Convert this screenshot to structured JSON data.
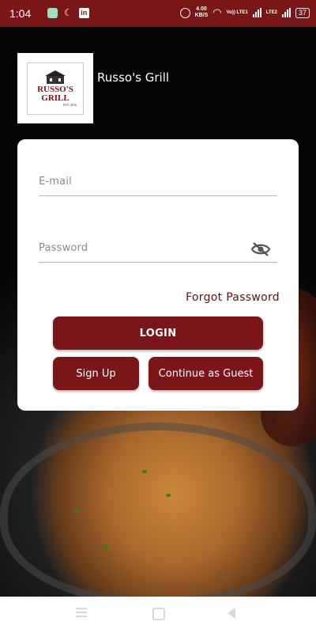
{
  "status_bar": {
    "time": "1:04",
    "speed_value": "4.00",
    "speed_unit": "KB/S",
    "volte_top": "Vo)) LTE1",
    "volte_bottom": "LTE2",
    "battery": "37",
    "icons": [
      "whatsapp-icon",
      "moon-icon",
      "linkedin-icon",
      "alarm-icon",
      "wifi-icon",
      "signal-icon",
      "battery-icon"
    ]
  },
  "header": {
    "logo": {
      "line1": "RUSSO'S",
      "line2": "GRILL",
      "est": "EST. 2016"
    },
    "restaurant_name": "Russo's Grill"
  },
  "login_form": {
    "email_placeholder": "E-mail",
    "password_placeholder": "Password",
    "forgot_password": "Forgot Password",
    "login_button": "LOGIN",
    "signup_button": "Sign Up",
    "guest_button": "Continue as Guest"
  },
  "colors": {
    "brand": "#7a1518",
    "link": "#5a1412",
    "card": "#ffffff"
  }
}
